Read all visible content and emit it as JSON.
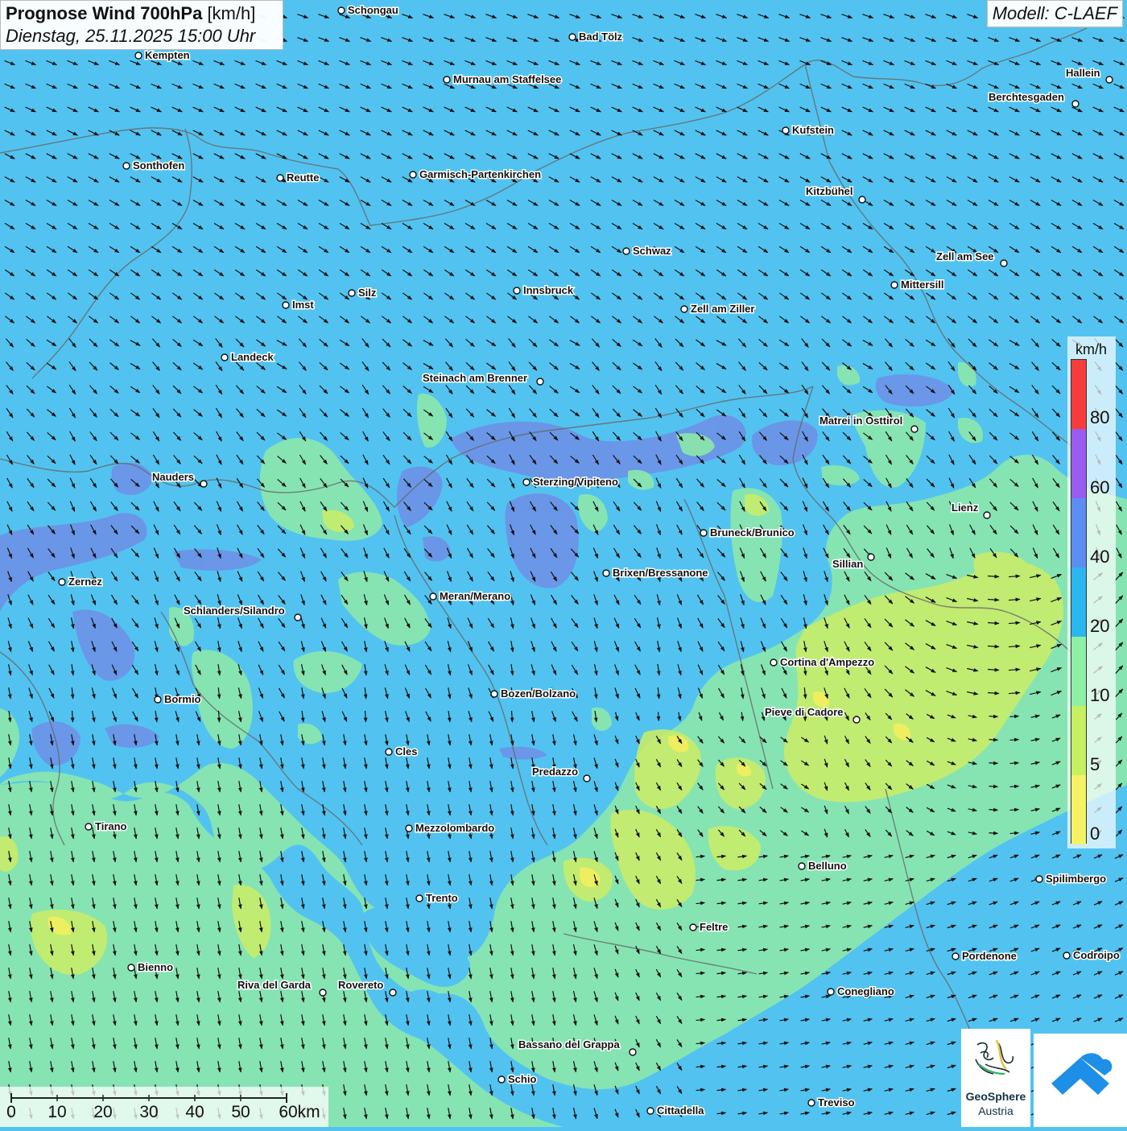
{
  "title": {
    "main": "Prognose Wind 700hPa",
    "unit": "[km/h]",
    "datetime": "Dienstag, 25.11.2025 15:00 Uhr"
  },
  "model": "Modell: C-LAEF",
  "legend": {
    "unit": "km/h",
    "ticks": [
      "80",
      "60",
      "40",
      "20",
      "10",
      "5",
      "0"
    ],
    "colors": [
      "#f73c3c",
      "#9a5cf0",
      "#5b8df2",
      "#2ab6ee",
      "#8df0a4",
      "#c6f062",
      "#f5f265"
    ]
  },
  "scalebar": {
    "labels": [
      "0",
      "10",
      "20",
      "30",
      "40",
      "50",
      "60km"
    ]
  },
  "logos": {
    "geosphere_line1": "GeoSphere",
    "geosphere_line2": "Austria"
  },
  "cities": [
    {
      "name": "Schongau"
    },
    {
      "name": "Bad Tölz"
    },
    {
      "name": "Kempten"
    },
    {
      "name": "Murnau am Staffelsee"
    },
    {
      "name": "Hallein"
    },
    {
      "name": "Berchtesgaden"
    },
    {
      "name": "Kufstein"
    },
    {
      "name": "Sonthofen"
    },
    {
      "name": "Reutte"
    },
    {
      "name": "Garmisch-Partenkirchen"
    },
    {
      "name": "Kitzbühel"
    },
    {
      "name": "Schwaz"
    },
    {
      "name": "Zell am See"
    },
    {
      "name": "Mittersill"
    },
    {
      "name": "Innsbruck"
    },
    {
      "name": "Silz"
    },
    {
      "name": "Imst"
    },
    {
      "name": "Zell am Ziller"
    },
    {
      "name": "Landeck"
    },
    {
      "name": "Steinach am Brenner"
    },
    {
      "name": "Matrei in Osttirol"
    },
    {
      "name": "Nauders"
    },
    {
      "name": "Sterzing/Vipiteno"
    },
    {
      "name": "Lienz"
    },
    {
      "name": "Bruneck/Brunico"
    },
    {
      "name": "Sillian"
    },
    {
      "name": "Brixen/Bressanone"
    },
    {
      "name": "Zernez"
    },
    {
      "name": "Meran/Merano"
    },
    {
      "name": "Schlanders/Silandro"
    },
    {
      "name": "Cortina d'Ampezzo"
    },
    {
      "name": "Bozen/Bolzano"
    },
    {
      "name": "Bormio"
    },
    {
      "name": "Pieve di Cadore"
    },
    {
      "name": "Cles"
    },
    {
      "name": "Predazzo"
    },
    {
      "name": "Tirano"
    },
    {
      "name": "Mezzolombardo"
    },
    {
      "name": "Belluno"
    },
    {
      "name": "Spilimbergo"
    },
    {
      "name": "Trento"
    },
    {
      "name": "Feltre"
    },
    {
      "name": "Pordenone"
    },
    {
      "name": "Codroipo"
    },
    {
      "name": "Bienno"
    },
    {
      "name": "Riva del Garda"
    },
    {
      "name": "Rovereto"
    },
    {
      "name": "Conegliano"
    },
    {
      "name": "Bassano del Grappa"
    },
    {
      "name": "Schio"
    },
    {
      "name": "Treviso"
    },
    {
      "name": "Cittadella"
    }
  ]
}
